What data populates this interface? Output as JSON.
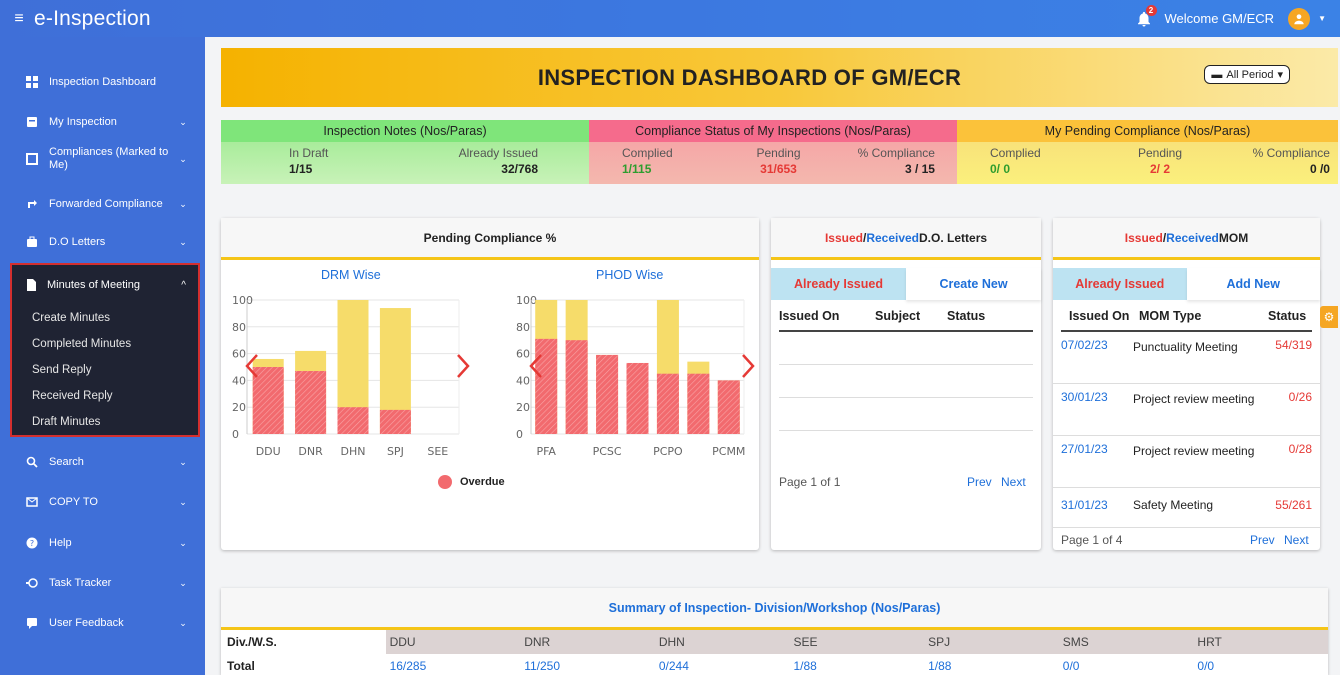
{
  "app": {
    "title": "e-Inspection",
    "notifications": "2",
    "welcome": "Welcome GM/ECR"
  },
  "sidebar": {
    "items": [
      {
        "label": "Inspection Dashboard",
        "icon": "dashboard-icon"
      },
      {
        "label": "My Inspection",
        "icon": "clipboard-icon"
      },
      {
        "label": "Compliances (Marked to Me)",
        "icon": "square-icon"
      },
      {
        "label": "Forwarded Compliance",
        "icon": "forward-icon"
      },
      {
        "label": "D.O Letters",
        "icon": "briefcase-icon"
      },
      {
        "label": "Search",
        "icon": "search-icon"
      },
      {
        "label": "COPY TO",
        "icon": "envelope-icon"
      },
      {
        "label": "Help",
        "icon": "help-icon"
      },
      {
        "label": "Task Tracker",
        "icon": "task-icon"
      },
      {
        "label": "User Feedback",
        "icon": "feedback-icon"
      }
    ],
    "mom": {
      "label": "Minutes of Meeting",
      "sub": [
        "Create Minutes",
        "Completed Minutes",
        "Send Reply",
        "Received Reply",
        "Draft Minutes"
      ]
    }
  },
  "banner": {
    "title": "INSPECTION DASHBOARD OF GM/ECR",
    "period": "All Period"
  },
  "stats": {
    "notes": {
      "title": "Inspection Notes (Nos/Paras)",
      "k1": "In Draft",
      "v1": "1/15",
      "k2": "Already Issued",
      "v2": "32/768"
    },
    "compliance": {
      "title": "Compliance Status of My Inspections (Nos/Paras)",
      "k1": "Complied",
      "v1": "1/115",
      "k2": "Pending",
      "v2": "31/653",
      "k3": "% Compliance",
      "v3": "3 / 15"
    },
    "pending": {
      "title": "My Pending Compliance (Nos/Paras)",
      "k1": "Complied",
      "v1": "0/ 0",
      "k2": "Pending",
      "v2": "2/ 2",
      "k3": "% Compliance",
      "v3": "0 /0"
    }
  },
  "pending_card": {
    "title": "Pending Compliance %",
    "drm_title": "DRM Wise",
    "phod_title": "PHOD Wise",
    "legend": "Overdue"
  },
  "colors": {
    "overdue": "#f26a6e",
    "total": "#f6dc6a"
  },
  "chart_data": [
    {
      "type": "bar",
      "title": "DRM Wise",
      "categories": [
        "DDU",
        "DNR",
        "DHN",
        "SPJ",
        "SEE"
      ],
      "series": [
        {
          "name": "Overdue",
          "values": [
            50,
            47,
            20,
            18,
            0
          ]
        },
        {
          "values": [
            56,
            62,
            100,
            94,
            0
          ]
        }
      ],
      "ylim": [
        0,
        100
      ],
      "yticks": [
        0,
        20,
        40,
        60,
        80,
        100
      ]
    },
    {
      "type": "bar",
      "title": "PHOD Wise",
      "categories": [
        "PFA",
        "PCSC",
        "PCPO",
        "PCMM"
      ],
      "bar_order": [
        "PFA",
        "",
        "PCSC",
        "",
        "PCPO",
        "",
        "PCMM"
      ],
      "series": [
        {
          "name": "Overdue",
          "values": [
            71,
            70,
            59,
            53,
            45,
            45,
            40
          ]
        },
        {
          "values": [
            100,
            100,
            59,
            53,
            100,
            54,
            40
          ]
        }
      ],
      "ylim": [
        0,
        100
      ],
      "yticks": [
        0,
        20,
        40,
        60,
        80,
        100
      ]
    }
  ],
  "do_letters": {
    "title_a": "Issued",
    "title_sep": "/",
    "title_b": "Received",
    "title_c": " D.O. Letters",
    "tab_active": "Already Issued",
    "tab_other": "Create New",
    "cols": [
      "Issued On",
      "Subject",
      "Status"
    ],
    "page": "Page 1 of 1",
    "prev": "Prev",
    "next": "Next"
  },
  "mom": {
    "title_a": "Issued",
    "title_sep": "/",
    "title_b": "Received",
    "title_c": " MOM",
    "tab_active": "Already Issued",
    "tab_other": "Add New",
    "cols": [
      "Issued On",
      "MOM Type",
      "Status"
    ],
    "rows": [
      {
        "date": "07/02/23",
        "type": "Punctuality Meeting",
        "status": "54/319"
      },
      {
        "date": "30/01/23",
        "type": "Project review meeting",
        "status": "0/26"
      },
      {
        "date": "27/01/23",
        "type": "Project review meeting",
        "status": "0/28"
      },
      {
        "date": "31/01/23",
        "type": "Safety Meeting",
        "status": "55/261"
      }
    ],
    "page": "Page 1 of 4",
    "prev": "Prev",
    "next": "Next"
  },
  "summary": {
    "title": "Summary of Inspection- Division/Workshop (Nos/Paras)",
    "head": [
      "Div./W.S.",
      "DDU",
      "DNR",
      "DHN",
      "SEE",
      "SPJ",
      "SMS",
      "HRT"
    ],
    "total": [
      "Total",
      "16/285",
      "11/250",
      "0/244",
      "1/88",
      "1/88",
      "0/0",
      "0/0"
    ]
  }
}
